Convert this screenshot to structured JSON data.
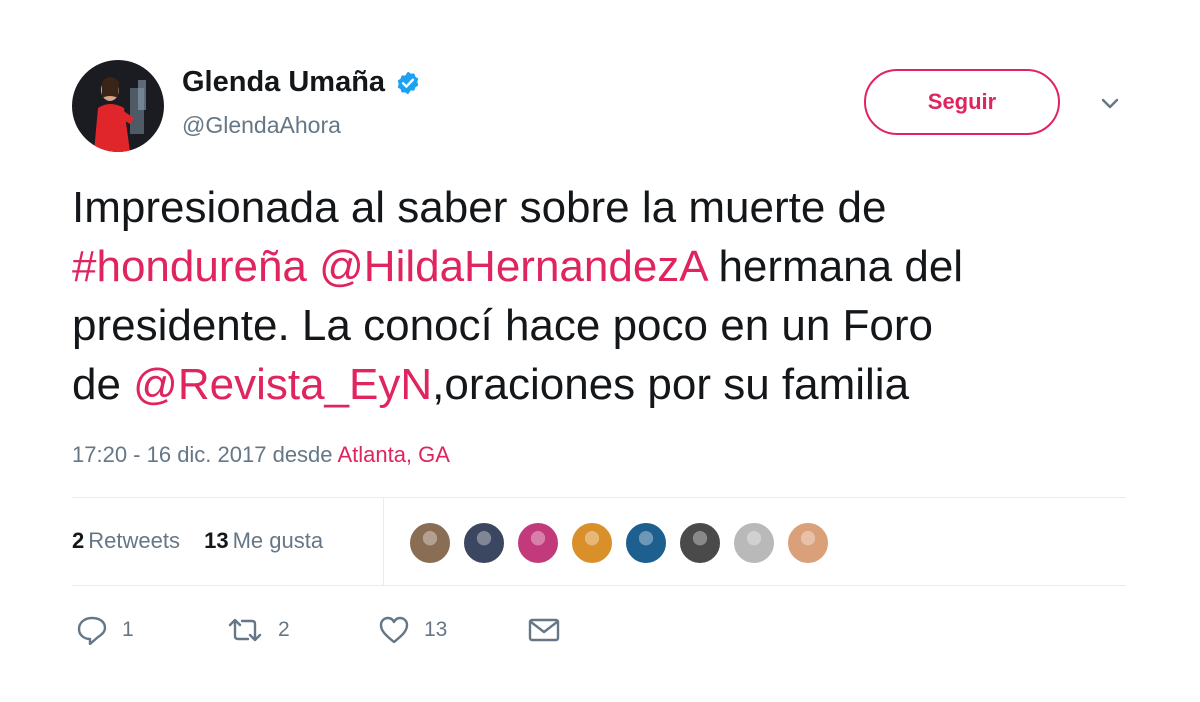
{
  "user": {
    "display_name": "Glenda Umaña",
    "handle": "@GlendaAhora",
    "verified_icon": "verified-badge-icon"
  },
  "follow_label": "Seguir",
  "tweet": {
    "lines": [
      [
        {
          "t": "Impresionada al saber sobre la muerte de",
          "link": false
        }
      ],
      [
        {
          "t": "#hondureña",
          "link": true
        },
        {
          "t": " ",
          "link": false
        },
        {
          "t": "@HildaHernandezA",
          "link": true
        },
        {
          "t": " hermana del",
          "link": false
        }
      ],
      [
        {
          "t": "presidente. La conocí hace poco en un Foro",
          "link": false
        }
      ],
      [
        {
          "t": "de ",
          "link": false
        },
        {
          "t": "@Revista_EyN",
          "link": true
        },
        {
          "t": ",oraciones por su familia",
          "link": false
        }
      ]
    ]
  },
  "meta": {
    "time": "17:20 - 16 dic. 2017 desde ",
    "location": "Atlanta, GA"
  },
  "stats": {
    "retweets_count": "2",
    "retweets_label": "Retweets",
    "likes_count": "13",
    "likes_label": "Me gusta"
  },
  "likers": [
    {
      "name": "liker-avatar-1",
      "bg": "#8a6d55"
    },
    {
      "name": "liker-avatar-2",
      "bg": "#3b4660"
    },
    {
      "name": "liker-avatar-3",
      "bg": "#c23a7c"
    },
    {
      "name": "liker-avatar-4",
      "bg": "#d9902b"
    },
    {
      "name": "liker-avatar-5",
      "bg": "#1d5f8f"
    },
    {
      "name": "liker-avatar-6",
      "bg": "#4a4a4a"
    },
    {
      "name": "liker-avatar-7",
      "bg": "#b9b9b9"
    },
    {
      "name": "liker-avatar-8",
      "bg": "#d9a07a"
    }
  ],
  "actions": {
    "reply_count": "1",
    "retweet_count": "2",
    "like_count": "13"
  },
  "colors": {
    "accent": "#e0245e",
    "text": "#14171a",
    "secondary": "#657786",
    "verified": "#1da1f2"
  }
}
